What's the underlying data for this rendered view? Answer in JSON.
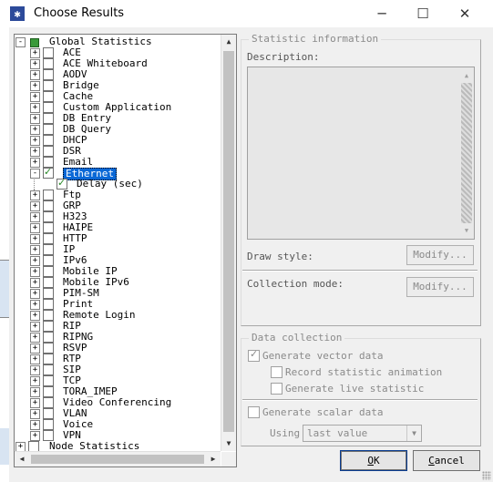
{
  "window": {
    "title": "Choose Results",
    "min_glyph": "─",
    "max_glyph": "☐",
    "close_glyph": "✕",
    "icon": "network-star-icon"
  },
  "tree": {
    "root_label": "Global Statistics",
    "items": [
      "ACE",
      "ACE Whiteboard",
      "AODV",
      "Bridge",
      "Cache",
      "Custom Application",
      "DB Entry",
      "DB Query",
      "DHCP",
      "DSR",
      "Email",
      "Ethernet",
      "Ftp",
      "GRP",
      "H323",
      "HAIPE",
      "HTTP",
      "IP",
      "IPv6",
      "Mobile IP",
      "Mobile IPv6",
      "PIM-SM",
      "Print",
      "Remote Login",
      "RIP",
      "RIPNG",
      "RSVP",
      "RTP",
      "SIP",
      "TCP",
      "TORA_IMEP",
      "Video Conferencing",
      "VLAN",
      "Voice",
      "VPN"
    ],
    "expanded_item": "Ethernet",
    "child_label": "Delay (sec)",
    "last_label": "Node Statistics"
  },
  "stat_info": {
    "legend": "Statistic information",
    "description_label": "Description:",
    "draw_style_label": "Draw style:",
    "collection_mode_label": "Collection mode:",
    "modify_label": "Modify..."
  },
  "data_collection": {
    "legend": "Data collection",
    "generate_vector": "Generate vector data",
    "record_animation": "Record statistic animation",
    "generate_live": "Generate live statistic",
    "generate_scalar": "Generate scalar data",
    "using_label": "Using",
    "using_value": "last value"
  },
  "buttons": {
    "ok_underline": "O",
    "ok_rest": "K",
    "cancel_underline": "C",
    "cancel_rest": "ancel"
  },
  "colors": {
    "selection": "#0a68d6",
    "check_green": "#2a8a2a",
    "disabled_text": "#8a8a8a"
  }
}
